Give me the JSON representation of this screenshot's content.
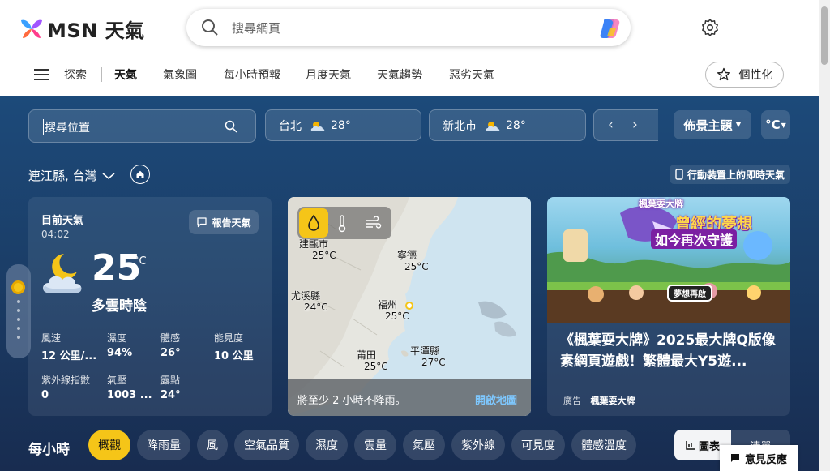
{
  "header": {
    "logo_text": "MSN 天氣",
    "search_placeholder": "搜尋網頁"
  },
  "nav": {
    "items": [
      "探索",
      "天氣",
      "氣象圖",
      "每小時預報",
      "月度天氣",
      "天氣趨勢",
      "惡劣天氣"
    ],
    "active": "天氣",
    "personalize": "個性化"
  },
  "location_search": {
    "placeholder": "搜尋位置"
  },
  "city_chips": [
    {
      "name": "台北",
      "temp": "28°"
    },
    {
      "name": "新北市",
      "temp": "28°"
    }
  ],
  "controls": {
    "theme": "佈景主題",
    "unit": "°C"
  },
  "location": {
    "title": "連江縣, 台灣",
    "mobile_link": "行動裝置上的即時天氣"
  },
  "current": {
    "label": "目前天氣",
    "time": "04:02",
    "report": "報告天氣",
    "temp": "25",
    "unit": "°C",
    "condition": "多雲時陰",
    "stats": [
      {
        "k": "風速",
        "v": "12 公里/..."
      },
      {
        "k": "濕度",
        "v": "94%"
      },
      {
        "k": "體感",
        "v": "26°"
      },
      {
        "k": "能見度",
        "v": "10 公里"
      },
      {
        "k": "紫外線指數",
        "v": "0"
      },
      {
        "k": "氣壓",
        "v": "1003 ..."
      },
      {
        "k": "露點",
        "v": "24°"
      }
    ]
  },
  "map": {
    "cities": [
      {
        "name": "建甌市",
        "temp": "25°C"
      },
      {
        "name": "寧德",
        "temp": "25°C"
      },
      {
        "name": "尤溪縣",
        "temp": "24°C"
      },
      {
        "name": "福州",
        "temp": "25°C"
      },
      {
        "name": "莆田",
        "temp": "25°C"
      },
      {
        "name": "平潭縣",
        "temp": "27°C"
      }
    ],
    "footer": "將至少 2 小時不降雨。",
    "open": "開啟地圖"
  },
  "ad": {
    "headline_top": "楓葉耍大牌",
    "banner_main": "曾經的夢想",
    "banner_sub": "如今再次守護",
    "button": "夢想再啟",
    "title": "《楓葉耍大牌》2025最大牌Q版像素網頁遊戲！繁體最大Y5遊...",
    "tag": "廣告",
    "advertiser": "楓葉耍大牌"
  },
  "hourly": {
    "title": "每小時",
    "pills": [
      "概觀",
      "降雨量",
      "風",
      "空氣品質",
      "濕度",
      "雲量",
      "氣壓",
      "紫外線",
      "可見度",
      "體感溫度"
    ],
    "active": "概觀",
    "chart": "圖表",
    "list": "清單"
  },
  "feedback": "意見反應",
  "colors": {
    "accent": "#f5c518",
    "bg_top": "#1c4a7a",
    "bg_bottom": "#182c50"
  }
}
